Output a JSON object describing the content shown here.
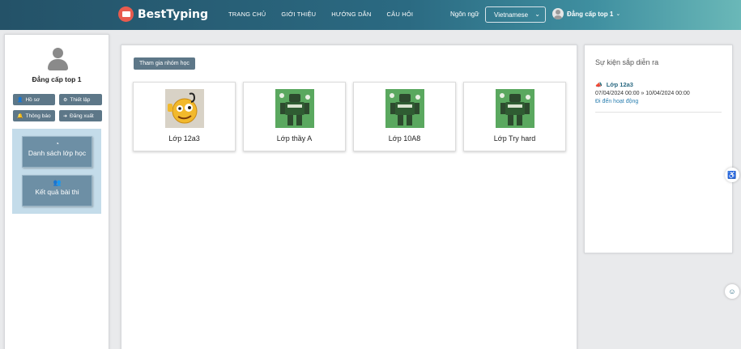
{
  "header": {
    "brand": "BestTyping",
    "nav": [
      "TRANG CHỦ",
      "GIỚI THIỆU",
      "HƯỚNG DẪN",
      "CÂU HỎI"
    ],
    "language_label": "Ngôn ngữ",
    "language_value": "Vietnamese",
    "user_name": "Đẳng cấp top 1"
  },
  "sidebar": {
    "profile_name": "Đẳng cấp top 1",
    "buttons": {
      "profile": "Hồ sơ",
      "settings": "Thiết lập",
      "notifications": "Thông báo",
      "logout": "Đăng xuất"
    },
    "menu": {
      "class_list": "Danh sách lớp học",
      "results": "Kết quả bài thi"
    }
  },
  "main": {
    "join_button": "Tham gia nhóm học",
    "classes": [
      {
        "name": "Lớp 12a3",
        "image": "emoji-character"
      },
      {
        "name": "Lớp thầy A",
        "image": "green-robot"
      },
      {
        "name": "Lớp 10A8",
        "image": "green-robot"
      },
      {
        "name": "Lớp Try hard",
        "image": "green-robot"
      }
    ]
  },
  "events": {
    "title": "Sự kiện sắp diễn ra",
    "items": [
      {
        "name": "Lớp 12a3",
        "time": "07/04/2024 00:00 » 10/04/2024 00:00",
        "link": "Đi đến hoạt động"
      }
    ]
  },
  "colors": {
    "header_start": "#245268",
    "header_end": "#6ab8b8",
    "button": "#5d7788",
    "menu_panel": "#c4dcea",
    "menu_card": "#6d8fa5",
    "link": "#2b7fb0"
  }
}
